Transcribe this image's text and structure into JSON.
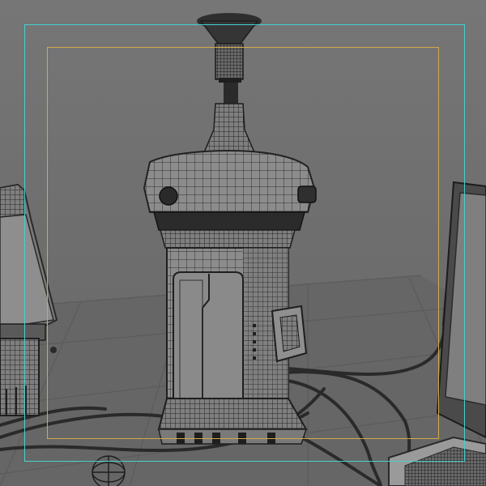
{
  "viewport": {
    "background": "#6f6f6f",
    "grid_color": "#5d5d5d",
    "mesh_color": "#2b2b2b",
    "surface_color": "#8b8b8b"
  },
  "overlays": {
    "safe_action_color": "#45d0d0",
    "safe_title_color": "#d1a94b"
  },
  "icons": {
    "gizmo": "rotate-gizmo-icon"
  }
}
